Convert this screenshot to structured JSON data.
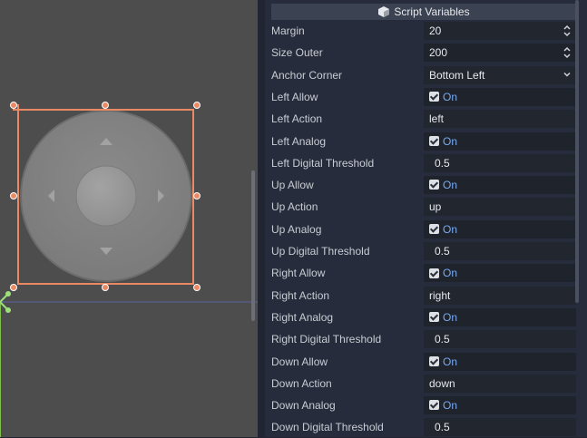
{
  "inspector": {
    "section_title": "Script Variables",
    "rows": [
      {
        "label": "Margin",
        "value": "20",
        "kind": "spin"
      },
      {
        "label": "Size Outer",
        "value": "200",
        "kind": "spin"
      },
      {
        "label": "Anchor Corner",
        "value": "Bottom Left",
        "kind": "select"
      },
      {
        "label": "Left Allow",
        "value": "On",
        "kind": "check"
      },
      {
        "label": "Left Action",
        "value": "left",
        "kind": "text"
      },
      {
        "label": "Left Analog",
        "value": "On",
        "kind": "check"
      },
      {
        "label": "Left Digital Threshold",
        "value": "0.5",
        "kind": "number"
      },
      {
        "label": "Up Allow",
        "value": "On",
        "kind": "check"
      },
      {
        "label": "Up Action",
        "value": "up",
        "kind": "text"
      },
      {
        "label": "Up Analog",
        "value": "On",
        "kind": "check"
      },
      {
        "label": "Up Digital Threshold",
        "value": "0.5",
        "kind": "number"
      },
      {
        "label": "Right Allow",
        "value": "On",
        "kind": "check"
      },
      {
        "label": "Right Action",
        "value": "right",
        "kind": "text"
      },
      {
        "label": "Right Analog",
        "value": "On",
        "kind": "check"
      },
      {
        "label": "Right Digital Threshold",
        "value": "0.5",
        "kind": "number"
      },
      {
        "label": "Down Allow",
        "value": "On",
        "kind": "check"
      },
      {
        "label": "Down Action",
        "value": "down",
        "kind": "text"
      },
      {
        "label": "Down Analog",
        "value": "On",
        "kind": "check"
      },
      {
        "label": "Down Digital Threshold",
        "value": "0.5",
        "kind": "number"
      }
    ]
  },
  "colors": {
    "selection": "#e98a64",
    "viewport_bg": "#4d4d4d",
    "inspector_bg": "#262c3b",
    "accent": "#7aaaf0"
  },
  "icons": {
    "section": "script-icon",
    "handle": "selection-handle-icon",
    "pivot": "pivot-icon"
  }
}
